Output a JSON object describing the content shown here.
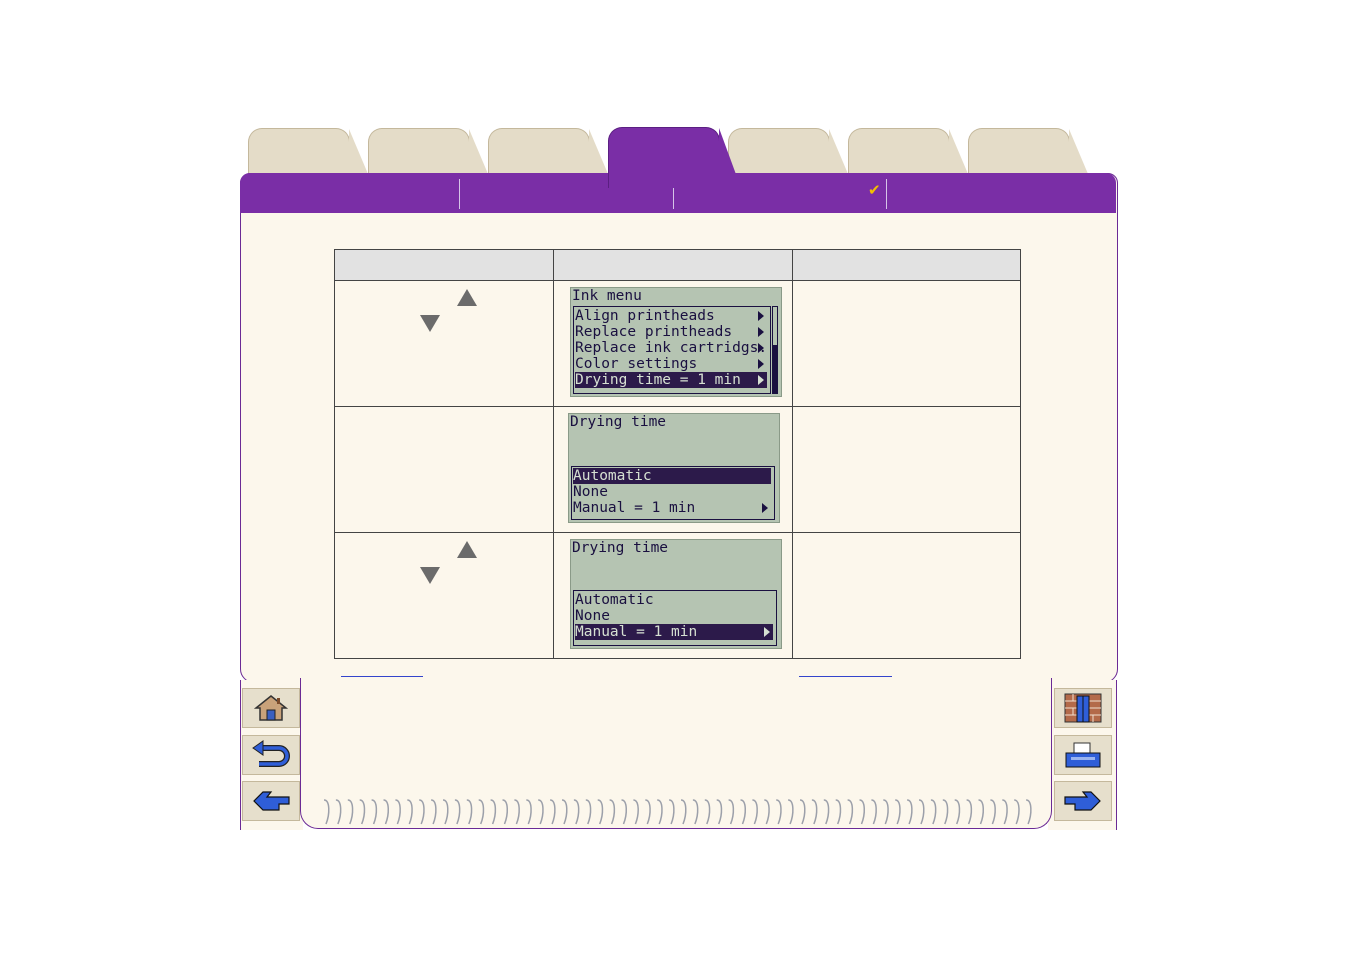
{
  "tabs": [
    {
      "label": ""
    },
    {
      "label": ""
    },
    {
      "label": ""
    },
    {
      "label": "",
      "active": true
    },
    {
      "label": ""
    },
    {
      "label": ""
    },
    {
      "label": ""
    }
  ],
  "header_bar": {
    "sections": [
      "",
      "",
      "",
      ""
    ],
    "check_mark": "✔"
  },
  "colors": {
    "accent": "#7a2ea6",
    "page": "#fcf7ec",
    "lcd": "#b5c4b2"
  },
  "table": {
    "headers": [
      "",
      "",
      ""
    ],
    "rows": [
      {
        "step_text": "",
        "buttons": [
          "up-arrow",
          "down-arrow"
        ],
        "display": {
          "title": "Ink menu",
          "items": [
            "Align printheads",
            "Replace printheads",
            "Replace ink cartridgs.",
            "Color settings",
            "Drying time = 1 min"
          ],
          "selected": 4,
          "has_submenu": [
            true,
            true,
            true,
            true,
            true
          ],
          "scrollbar": true
        },
        "note": ""
      },
      {
        "step_text": "",
        "buttons": [],
        "display": {
          "title": "Drying time",
          "items": [
            "Automatic",
            "None",
            "Manual = 1 min"
          ],
          "selected": 0,
          "has_submenu": [
            false,
            false,
            true
          ]
        },
        "note": ""
      },
      {
        "step_text": "",
        "buttons": [
          "up-arrow",
          "down-arrow"
        ],
        "display": {
          "title": "Drying time",
          "items": [
            "Automatic",
            "None",
            "Manual = 1 min"
          ],
          "selected": 2,
          "has_submenu": [
            false,
            false,
            true
          ]
        },
        "note": ""
      }
    ]
  },
  "links": {
    "previous": "",
    "next": ""
  },
  "nav": {
    "left": [
      "home-icon",
      "back-icon",
      "previous-page-icon"
    ],
    "right": [
      "contents-icon",
      "printer-icon",
      "next-page-icon"
    ]
  }
}
